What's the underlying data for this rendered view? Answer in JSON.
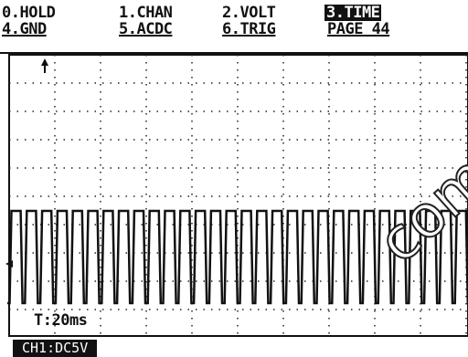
{
  "menu": {
    "row1": [
      {
        "label": "0.HOLD",
        "selected": false
      },
      {
        "label": "1.CHAN",
        "selected": false
      },
      {
        "label": "2.VOLT",
        "selected": false
      },
      {
        "label": "3.TIME",
        "selected": true
      }
    ],
    "row2": [
      {
        "label": "4.GND",
        "selected": false
      },
      {
        "label": "5.ACDC",
        "selected": false
      },
      {
        "label": "6.TRIG",
        "selected": false
      },
      {
        "label": "PAGE 44",
        "selected": false
      }
    ]
  },
  "status": {
    "time_base": "T:20ms",
    "channel_info": "CH1:DC5V"
  },
  "markers": {
    "trigger_position": "up-arrow",
    "ground_level": "left-arrow"
  },
  "watermark": "com",
  "colors": {
    "background": "#ffffff",
    "foreground": "#111111",
    "selected_bg": "#111111",
    "selected_fg": "#ffffff"
  },
  "waveform": {
    "type": "square",
    "cycles": 30,
    "duty_high": 0.72
  }
}
